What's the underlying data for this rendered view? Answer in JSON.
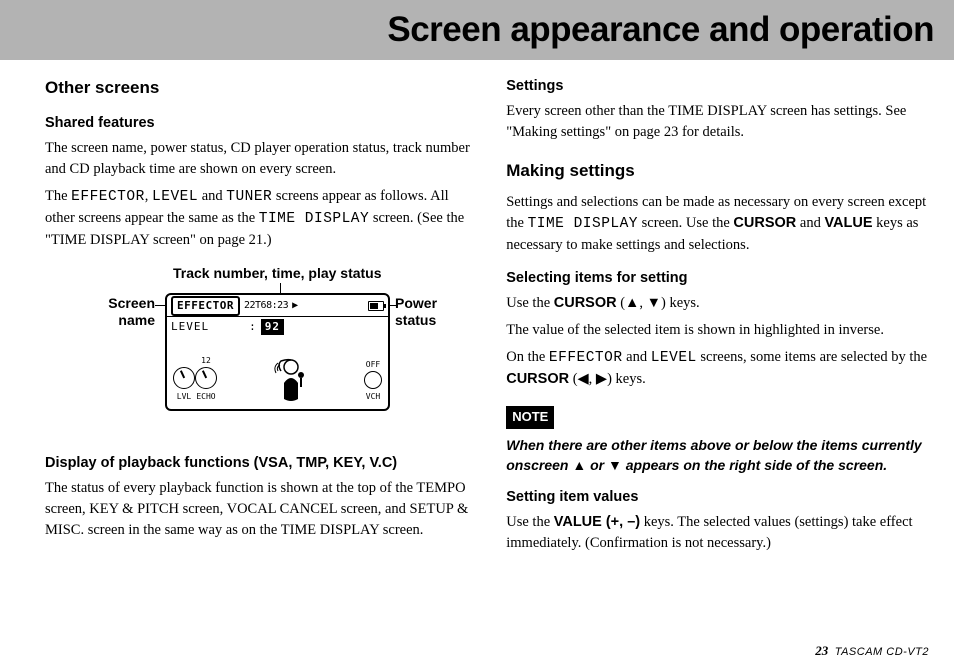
{
  "header": {
    "title": "Screen appearance and operation"
  },
  "left": {
    "h2_other": "Other screens",
    "h3_shared": "Shared features",
    "p1": "The screen name, power status, CD player operation status, track number and CD playback time are shown on every screen.",
    "p2a": "The ",
    "p2_eff": "EFFECTOR",
    "p2b": ", ",
    "p2_lvl": "LEVEL",
    "p2c": " and ",
    "p2_tun": "TUNER",
    "p2d": " screens appear as follows. All other screens appear the same as the ",
    "p2_td": "TIME DISPLAY",
    "p2e": " screen. (See the \"TIME DISPLAY screen\" on page 21.)",
    "diag": {
      "track_label": "Track number, time, play status",
      "screen_label": "Screen\nname",
      "power_label": "Power\nstatus",
      "lcd_effector": "EFFECTOR",
      "lcd_time": "22T68:23",
      "lcd_level": "LEVEL",
      "lcd_colon": ":",
      "lcd_value": "92",
      "knob_num": "12",
      "knob1": "LVL",
      "knob2": "ECHO",
      "vch_off": "OFF",
      "vch": "VCH"
    },
    "h3_playback": "Display of playback functions (VSA, TMP, KEY, V.C)",
    "p3": "The status of every playback function is shown at the top of the TEMPO screen, KEY & PITCH screen, VOCAL CANCEL screen, and SETUP & MISC. screen in the same way as on the TIME DISPLAY screen."
  },
  "right": {
    "h3_settings": "Settings",
    "p1": "Every screen other than the TIME DISPLAY screen has settings. See \"Making settings\" on page 23 for details.",
    "h2_making": "Making settings",
    "p2a": "Settings and selections can be made as necessary on every screen except the ",
    "p2_td": "TIME DISPLAY",
    "p2b": " screen. Use the ",
    "p2_cursor": "CURSOR",
    "p2c": " and ",
    "p2_value": "VALUE",
    "p2d": " keys as necessary to make settings and selections.",
    "h3_selecting": "Selecting items for setting",
    "p3a": "Use the ",
    "p3_cursor": "CURSOR",
    "p3b": " (▲, ▼) keys.",
    "p4": "The value of the selected item is shown in highlighted in inverse.",
    "p5a": "On the ",
    "p5_eff": "EFFECTOR",
    "p5b": " and ",
    "p5_lvl": "LEVEL",
    "p5c": " screens, some items are selected by the ",
    "p5_cursor": "CURSOR",
    "p5d": " (◀, ▶) keys.",
    "note_badge": "NOTE",
    "note_text": "When there are other items above or below the items currently onscreen ▲ or ▼ appears on the right side of the screen.",
    "h3_values": "Setting item values",
    "p6a": "Use the ",
    "p6_value": "VALUE (+, –)",
    "p6b": " keys. The selected values (settings) take effect immediately. (Confirmation is not necessary.)"
  },
  "footer": {
    "page": "23",
    "model": "TASCAM  CD-VT2"
  }
}
